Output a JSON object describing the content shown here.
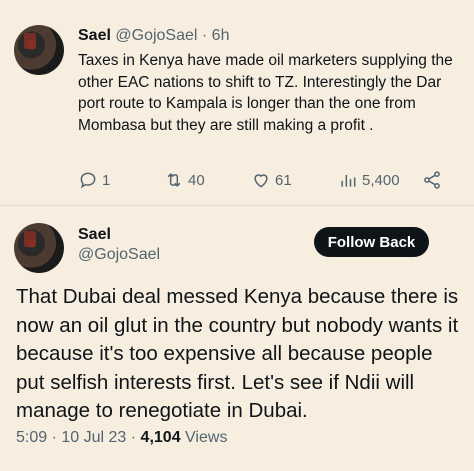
{
  "tweet1": {
    "name": "Sael",
    "handle": "@GojoSael",
    "separator": "·",
    "time": "6h",
    "text": "Taxes in Kenya have made oil marketers supplying the other EAC nations to shift to TZ. Interestingly the Dar port route to Kampala is longer than the one from Mombasa but they are still making a profit .",
    "actions": {
      "reply_icon": "reply-icon",
      "reply_count": "1",
      "retweet_icon": "retweet-icon",
      "retweet_count": "40",
      "like_icon": "heart-icon",
      "like_count": "61",
      "views_icon": "views-icon",
      "views_count": "5,400",
      "share_icon": "share-icon"
    }
  },
  "tweet2": {
    "name": "Sael",
    "handle": "@GojoSael",
    "follow_label": "Follow Back",
    "text": "That Dubai deal messed Kenya because there is now an oil glut in the country but nobody wants it because it's too expensive all because people put selfish interests first. Let's see if Ndii will manage to renegotiate in Dubai.",
    "time": "5:09",
    "date": "10 Jul 23",
    "separator": "·",
    "views_count": "4,104",
    "views_label": "Views"
  },
  "colors": {
    "background": "#f7eedf",
    "text": "#0f1419",
    "muted": "#536471",
    "button": "#0f1419"
  }
}
